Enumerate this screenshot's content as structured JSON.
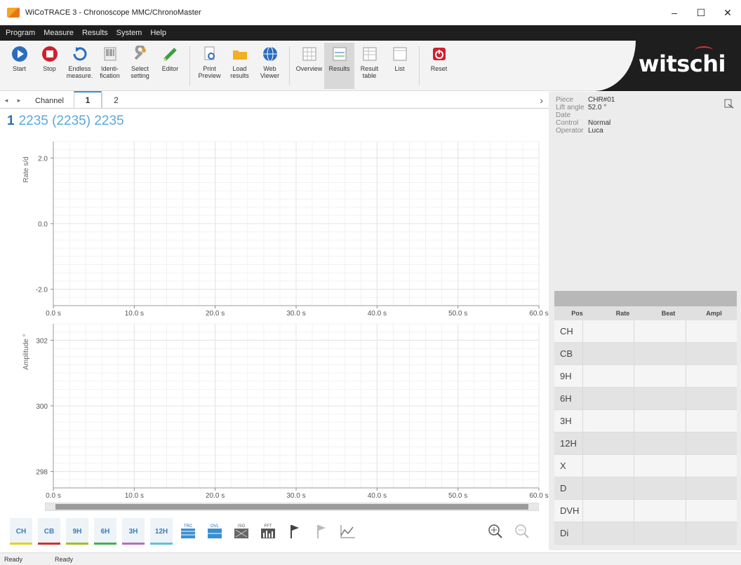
{
  "window": {
    "title": "WiCoTRACE 3 - Chronoscope MMC/ChronoMaster",
    "min": "–",
    "max": "☐",
    "close": "✕"
  },
  "menu": [
    "Program",
    "Measure",
    "Results",
    "System",
    "Help"
  ],
  "toolbar": [
    {
      "label": "Start",
      "icon": "play-icon"
    },
    {
      "label": "Stop",
      "icon": "stop-icon"
    },
    {
      "label": "Endless\nmeasure.",
      "icon": "loop-icon"
    },
    {
      "label": "Identi-\nfication",
      "icon": "barcode-icon"
    },
    {
      "label": "Select\nsetting",
      "icon": "wrench-icon"
    },
    {
      "label": "Editor",
      "icon": "pencil-icon"
    },
    {
      "label": "Print\nPreview",
      "icon": "print-preview-icon"
    },
    {
      "label": "Load\nresults",
      "icon": "folder-icon"
    },
    {
      "label": "Web\nViewer",
      "icon": "globe-icon"
    },
    {
      "label": "Overview",
      "icon": "grid-icon"
    },
    {
      "label": "Results",
      "icon": "results-icon"
    },
    {
      "label": "Result\ntable",
      "icon": "table-icon"
    },
    {
      "label": "List",
      "icon": "list-icon"
    },
    {
      "label": "Reset",
      "icon": "power-icon"
    }
  ],
  "brand": "witschi",
  "tabs": {
    "label": "Channel",
    "items": [
      "1",
      "2"
    ],
    "active": "1"
  },
  "heading": {
    "channel": "1",
    "text": "2235 (2235) 2235"
  },
  "chart_data": [
    {
      "type": "line",
      "title": "",
      "ylabel": "Rate  s/d",
      "xlabel": "",
      "xlim": [
        0,
        60
      ],
      "ylim": [
        -2.5,
        2.5
      ],
      "yticks": [
        "2.0",
        "0.0",
        "-2.0"
      ],
      "ytick_values": [
        2.0,
        0.0,
        -2.0
      ],
      "xticks": [
        "0.0 s",
        "10.0 s",
        "20.0 s",
        "30.0 s",
        "40.0 s",
        "50.0 s",
        "60.0 s"
      ],
      "series": []
    },
    {
      "type": "line",
      "title": "",
      "ylabel": "Amplitude  °",
      "xlabel": "",
      "xlim": [
        0,
        60
      ],
      "ylim": [
        297.5,
        302.5
      ],
      "yticks": [
        "302",
        "300",
        "298"
      ],
      "ytick_values": [
        302,
        300,
        298
      ],
      "xticks": [
        "0.0 s",
        "10.0 s",
        "20.0 s",
        "30.0 s",
        "40.0 s",
        "50.0 s",
        "60.0 s"
      ],
      "series": []
    }
  ],
  "positions": [
    {
      "label": "CH",
      "color": "#e8d020"
    },
    {
      "label": "CB",
      "color": "#d03030"
    },
    {
      "label": "9H",
      "color": "#a0c020"
    },
    {
      "label": "6H",
      "color": "#40b050"
    },
    {
      "label": "3H",
      "color": "#b070c0"
    },
    {
      "label": "12H",
      "color": "#60c0e0"
    }
  ],
  "pos_tools": [
    {
      "label": "TRC",
      "icon": "trace-icon"
    },
    {
      "label": "OVL",
      "icon": "overlay-icon"
    },
    {
      "label": "ISO",
      "icon": "iso-icon"
    },
    {
      "label": "FFT",
      "icon": "fft-icon"
    }
  ],
  "info": [
    {
      "key": "Piece",
      "value": "CHR#01"
    },
    {
      "key": "Lift angle",
      "value": "52.0 °"
    },
    {
      "key": "Date",
      "value": ""
    },
    {
      "key": "Control",
      "value": "Normal"
    },
    {
      "key": "Operator",
      "value": "Luca"
    }
  ],
  "results": {
    "columns": [
      "Pos",
      "Rate",
      "Beat",
      "Ampl"
    ],
    "rows": [
      "CH",
      "CB",
      "9H",
      "6H",
      "3H",
      "12H",
      "X",
      "D",
      "DVH",
      "Di"
    ]
  },
  "status": [
    "Ready",
    "Ready"
  ]
}
